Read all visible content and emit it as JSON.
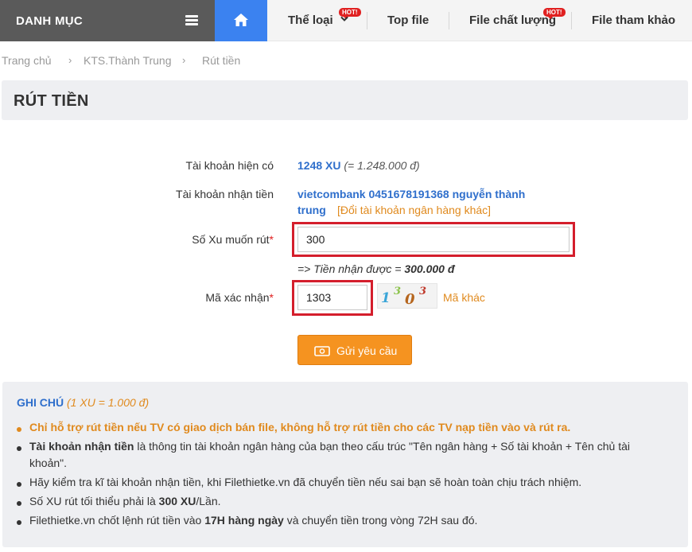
{
  "nav": {
    "danh_muc": "DANH MỤC",
    "items": [
      {
        "label": "Thể loại",
        "badge": "HOT!"
      },
      {
        "label": "Top file"
      },
      {
        "label": "File chất lượng",
        "badge": "HOT!"
      },
      {
        "label": "File tham khảo"
      }
    ]
  },
  "breadcrumb": [
    "Trang chủ",
    "KTS.Thành Trung",
    "Rút tiền"
  ],
  "page_title": "RÚT TIỀN",
  "form": {
    "account_label": "Tài khoản hiện có",
    "account_xu": "1248 XU",
    "account_vnd": "(= 1.248.000 đ)",
    "receive_label": "Tài khoản nhận tiền",
    "receive_line1": "vietcombank 0451678191368 nguyễn thành",
    "receive_line2": "trung",
    "change_bank": "[Đổi tài khoản ngân hàng khác]",
    "amount_label": "Số Xu muốn rút",
    "required_mark": "*",
    "amount_value": "300",
    "receive_amount_prefix": "=> Tiền nhận được =",
    "receive_amount": "300.000 đ",
    "captcha_label": "Mã xác nhận",
    "captcha_value": "1303",
    "captcha_chars": [
      "1",
      "3",
      "0",
      "3"
    ],
    "captcha_other": "Mã khác",
    "submit_label": "Gửi yêu cầu"
  },
  "notes": {
    "title": "GHI CHÚ",
    "rate": "(1 XU = 1.000 đ)",
    "line1": "Chỉ hỗ trợ rút tiền nếu TV có giao dịch bán file, không hỗ trợ rút tiền cho các TV nạp tiền vào và rút ra.",
    "line2_bold": "Tài khoản nhận tiền",
    "line2_rest": " là thông tin tài khoản ngân hàng của bạn theo cấu trúc \"Tên ngân hàng + Số tài khoản + Tên chủ tài khoản\".",
    "line3": "Hãy kiểm tra kĩ tài khoản nhận tiền, khi Filethietke.vn đã chuyển tiền nếu sai bạn sẽ hoàn toàn chịu trách nhiệm.",
    "line4_pre": "Số XU rút tối thiểu phải là ",
    "line4_bold": "300 XU",
    "line4_post": "/Lần.",
    "line5_pre": "Filethietke.vn chốt lệnh rút tiền vào ",
    "line5_bold": "17H hàng ngày",
    "line5_post": " và chuyển tiền trong vòng 72H sau đó."
  },
  "colors": {
    "accent_blue": "#3b82f0",
    "link_blue": "#2f6fcc",
    "orange": "#f59320",
    "highlight_red": "#d41e2c"
  }
}
